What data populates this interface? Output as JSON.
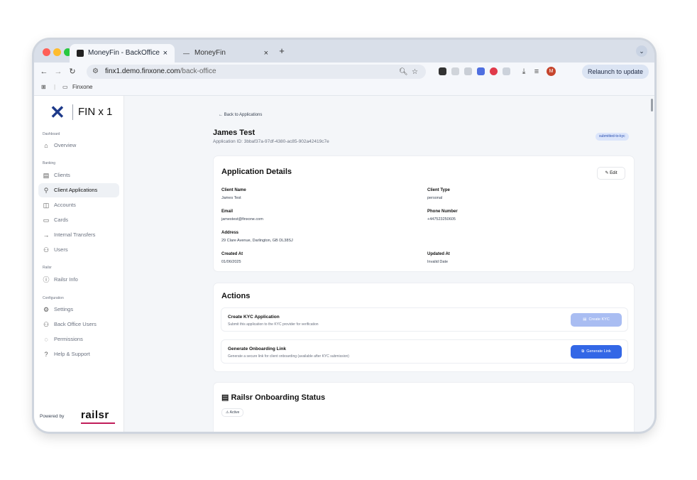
{
  "browser": {
    "tabs": [
      {
        "title": "MoneyFin - BackOffice",
        "close": "×"
      },
      {
        "title": "MoneyFin",
        "close": "×"
      }
    ],
    "new_tab": "+",
    "url_host": "finx1.demo.finxone.com",
    "url_path": "/back-office",
    "relaunch_label": "Relaunch to update",
    "profile_initial": "M",
    "bookmark_folder": "Finxone"
  },
  "sidebar": {
    "logo_mark": "✕",
    "logo_text": "FIN x 1",
    "sections": [
      {
        "label": "Dashboard",
        "items": [
          {
            "label": "Overview",
            "icon": "home-icon"
          }
        ]
      },
      {
        "label": "Banking",
        "items": [
          {
            "label": "Clients",
            "icon": "clipboard-icon"
          },
          {
            "label": "Client Applications",
            "icon": "user-check-icon"
          },
          {
            "label": "Accounts",
            "icon": "wallet-icon"
          },
          {
            "label": "Cards",
            "icon": "card-icon"
          },
          {
            "label": "Internal Transfers",
            "icon": "arrow-right-icon"
          },
          {
            "label": "Users",
            "icon": "users-icon"
          }
        ]
      },
      {
        "label": "Railsr",
        "items": [
          {
            "label": "Railsr Info",
            "icon": "info-icon"
          }
        ]
      },
      {
        "label": "Configuration",
        "items": [
          {
            "label": "Settings",
            "icon": "gear-icon"
          },
          {
            "label": "Back Office Users",
            "icon": "users-icon"
          },
          {
            "label": "Permissions",
            "icon": "shield-icon"
          },
          {
            "label": "Help & Support",
            "icon": "help-icon"
          }
        ]
      }
    ],
    "active_item": "Client Applications",
    "powered_by": "Powered by",
    "railsr_logo": "railsr"
  },
  "main": {
    "back_link": "Back to Applications",
    "title": "James Test",
    "application_id": "Application ID: 3bbaf37a-97df-4380-ac85-902a42419c7e",
    "status_badge": "submitted-to-kyc",
    "details": {
      "heading": "Application Details",
      "edit_label": "Edit",
      "fields": {
        "client_name": {
          "label": "Client Name",
          "value": "James Test"
        },
        "client_type": {
          "label": "Client Type",
          "value": "personal"
        },
        "email": {
          "label": "Email",
          "value": "jamestest@finxone.com"
        },
        "phone": {
          "label": "Phone Number",
          "value": "+447523250605"
        },
        "address": {
          "label": "Address",
          "value": "29 Clare Avenue, Darlington, GB DL38SJ"
        },
        "created_at": {
          "label": "Created At",
          "value": "01/06/2025"
        },
        "updated_at": {
          "label": "Updated At",
          "value": "Invalid Date"
        }
      }
    },
    "actions": {
      "heading": "Actions",
      "items": [
        {
          "title": "Create KYC Application",
          "description": "Submit this application to the KYC provider for verification",
          "button": "Create KYC",
          "enabled": false
        },
        {
          "title": "Generate Onboarding Link",
          "description": "Generate a secure link for client onboarding (available after KYC submission)",
          "button": "Generate Link",
          "enabled": true
        }
      ]
    },
    "railsr_status": {
      "heading": "Railsr Onboarding Status",
      "badge": "Active"
    }
  },
  "colors": {
    "primary": "#3367e6",
    "primary_disabled": "#a9bdf2",
    "badge_bg": "#dbe5fb",
    "brand_dark": "#1e3a8a",
    "railsr_accent": "#c11d5a"
  }
}
